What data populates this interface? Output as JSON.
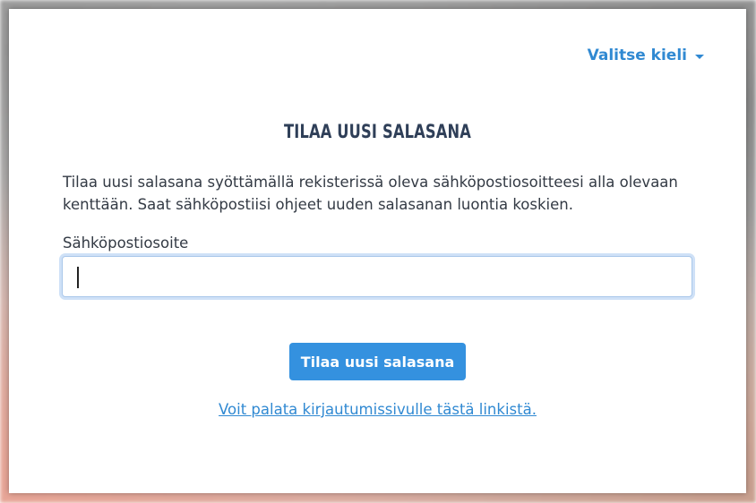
{
  "language_selector": {
    "label": "Valitse kieli",
    "icon": "caret-down-icon"
  },
  "form": {
    "title": "TILAA UUSI SALASANA",
    "description": "Tilaa uusi salasana syöttämällä rekisterissä oleva sähköpostiosoitteesi alla olevaan kenttään. Saat sähköpostiisi ohjeet uuden salasanan luontia koskien.",
    "email_label": "Sähköpostiosoite",
    "email_value": "",
    "email_placeholder": "",
    "submit_label": "Tilaa uusi salasana",
    "back_link": "Voit palata kirjautumissivulle tästä linkistä."
  },
  "colors": {
    "accent": "#3089d2",
    "button": "#3491df",
    "title": "#2f3f58",
    "text": "#333a44",
    "focus_ring": "#cfe1f7"
  }
}
